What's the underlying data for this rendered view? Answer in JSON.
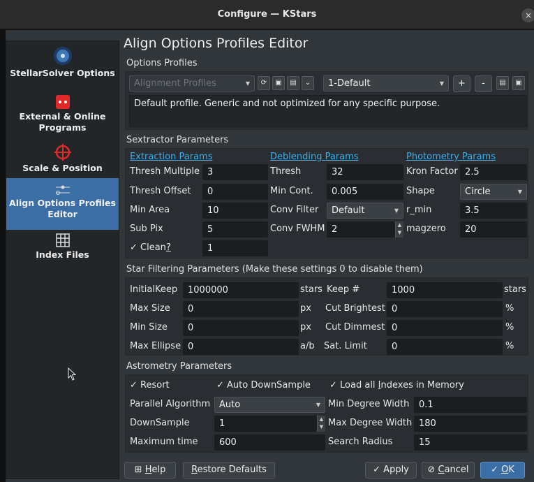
{
  "window": {
    "title": "Configure — KStars",
    "close_glyph": "×"
  },
  "sidebar": {
    "items": [
      {
        "label": "StellarSolver Options",
        "icon": "stellarsolver-icon"
      },
      {
        "label": "External & Online Programs",
        "icon": "external-programs-icon"
      },
      {
        "label": "Scale & Position",
        "icon": "crosshair-icon"
      },
      {
        "label": "Align Options Profiles Editor",
        "icon": "slider-icon",
        "selected": true
      },
      {
        "label": "Index Files",
        "icon": "grid-icon"
      }
    ]
  },
  "page": {
    "title": "Align Options Profiles Editor"
  },
  "profiles": {
    "section_title": "Options Profiles",
    "type_combo": "Alignment Profiles",
    "selected_profile": "1-Default",
    "description": "Default profile. Generic and not optimized for any specific purpose.",
    "add_label": "+",
    "remove_label": "-"
  },
  "sextractor": {
    "section_title": "Sextractor Parameters",
    "extraction": {
      "title": "Extraction Params",
      "thresh_multiple": {
        "label": "Thresh Multiple",
        "value": "3"
      },
      "thresh_offset": {
        "label": "Thresh Offset",
        "value": "0"
      },
      "min_area": {
        "label": "Min Area",
        "value": "10"
      },
      "sub_pix": {
        "label": "Sub Pix",
        "value": "5"
      },
      "clean": {
        "label_pre": "Clean",
        "label_u": "?",
        "checked": true,
        "value": "1"
      }
    },
    "deblending": {
      "title": "Deblending Params",
      "thresh": {
        "label": "Thresh",
        "value": "32"
      },
      "min_cont": {
        "label": "Min Cont.",
        "value": "0.005"
      },
      "conv_filter": {
        "label": "Conv Filter",
        "value": "Default"
      },
      "conv_fwhm": {
        "label": "Conv FWHM",
        "value": "2"
      }
    },
    "photometry": {
      "title": "Photometry Params",
      "kron_factor": {
        "label": "Kron Factor",
        "value": "2.5"
      },
      "shape": {
        "label": "Shape",
        "value": "Circle"
      },
      "r_min": {
        "label": "r_min",
        "value": "3.5"
      },
      "magzero": {
        "label": "magzero",
        "value": "20"
      }
    }
  },
  "star_filtering": {
    "section_title": "Star Filtering Parameters (Make these settings 0 to disable them)",
    "initial_keep": {
      "label": "InitialKeep",
      "value": "1000000",
      "unit": "stars"
    },
    "max_size": {
      "label": "Max Size",
      "value": "0",
      "unit": "px"
    },
    "min_size": {
      "label": "Min Size",
      "value": "0",
      "unit": "px"
    },
    "max_ellipse": {
      "label": "Max Ellipse",
      "value": "0",
      "unit": "a/b"
    },
    "keep_num": {
      "label": "Keep #",
      "value": "1000",
      "unit": "stars"
    },
    "cut_brightest": {
      "label": "Cut Brightest",
      "value": "0",
      "unit": "%"
    },
    "cut_dimmest": {
      "label": "Cut Dimmest",
      "value": "0",
      "unit": "%"
    },
    "sat_limit": {
      "label": "Sat. Limit",
      "value": "0",
      "unit": "%"
    }
  },
  "astrometry": {
    "section_title": "Astrometry Parameters",
    "resort": {
      "label": "Resort",
      "checked": true
    },
    "auto_downsample": {
      "label": "Auto DownSample",
      "checked": true
    },
    "load_all_indexes": {
      "label_pre": "Load all ",
      "label_u": "I",
      "label_post": "ndexes in Memory",
      "checked": true
    },
    "parallel_algorithm": {
      "label": "Parallel Algorithm",
      "value": "Auto"
    },
    "downsample": {
      "label": "DownSample",
      "value": "1"
    },
    "maximum_time": {
      "label": "Maximum time",
      "value": "600"
    },
    "min_degree_width": {
      "label": "Min Degree Width",
      "value": "0.1"
    },
    "max_degree_width": {
      "label": "Max Degree Width",
      "value": "180"
    },
    "search_radius": {
      "label": "Search Radius",
      "value": "15"
    }
  },
  "buttons": {
    "help_u": "H",
    "help_rest": "elp",
    "restore_u": "R",
    "restore_rest": "estore Defaults",
    "apply": "Apply",
    "cancel_u": "C",
    "cancel_rest": "ancel",
    "ok_u": "O",
    "ok_rest": "K"
  },
  "colors": {
    "accent": "#3a6ea5",
    "link": "#3daee9",
    "background": "#31363b"
  }
}
